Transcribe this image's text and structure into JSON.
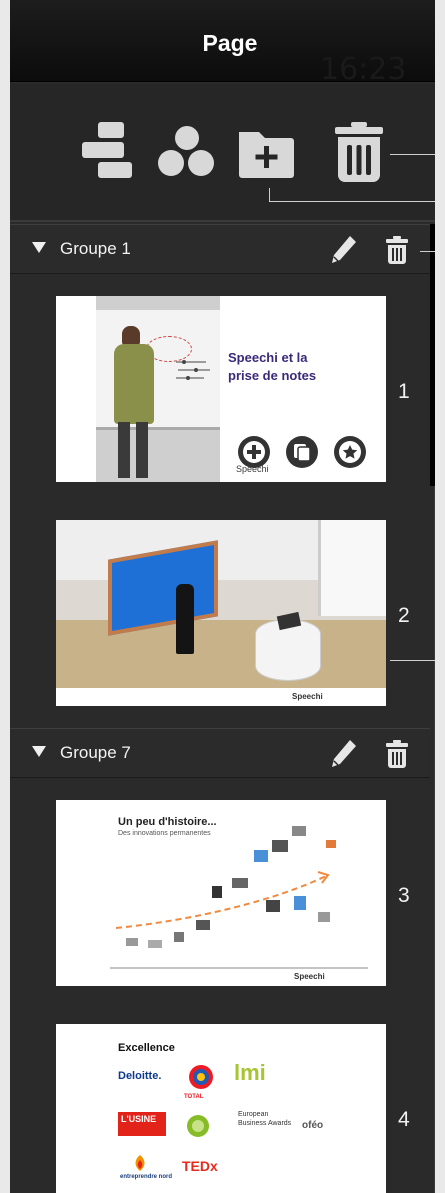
{
  "panel": {
    "title": "Page",
    "clock": "16:23"
  },
  "toolbar": {
    "tools": [
      {
        "icon": "layout-blocks-icon"
      },
      {
        "icon": "three-circles-icon"
      },
      {
        "icon": "add-folder-icon"
      },
      {
        "icon": "trash-icon"
      }
    ]
  },
  "groups": [
    {
      "name": "Groupe 1",
      "pages": [
        {
          "number": "1",
          "title_line1": "Speechi et la",
          "title_line2": "prise de notes",
          "caption": "Speechi"
        },
        {
          "number": "2",
          "footer_brand": "Speechi"
        }
      ]
    },
    {
      "name": "Groupe 7",
      "pages": [
        {
          "number": "3",
          "title": "Un peu d'histoire...",
          "subtitle": "Des innovations permanentes",
          "footer_brand": "Speechi"
        },
        {
          "number": "4",
          "title": "Excellence",
          "logos": [
            "Deloitte.",
            "TOTAL",
            "lmi",
            "L'USINE",
            "European Business Awards",
            "oféo",
            "entreprendre nord",
            "TEDx"
          ]
        }
      ]
    }
  ],
  "colors": {
    "panel_bg": "#2a2a2a",
    "accent_purple": "#3b2a7a",
    "tedx_red": "#e62b1e",
    "deloitte_green": "#86bc25",
    "total_red": "#ed1c24"
  }
}
